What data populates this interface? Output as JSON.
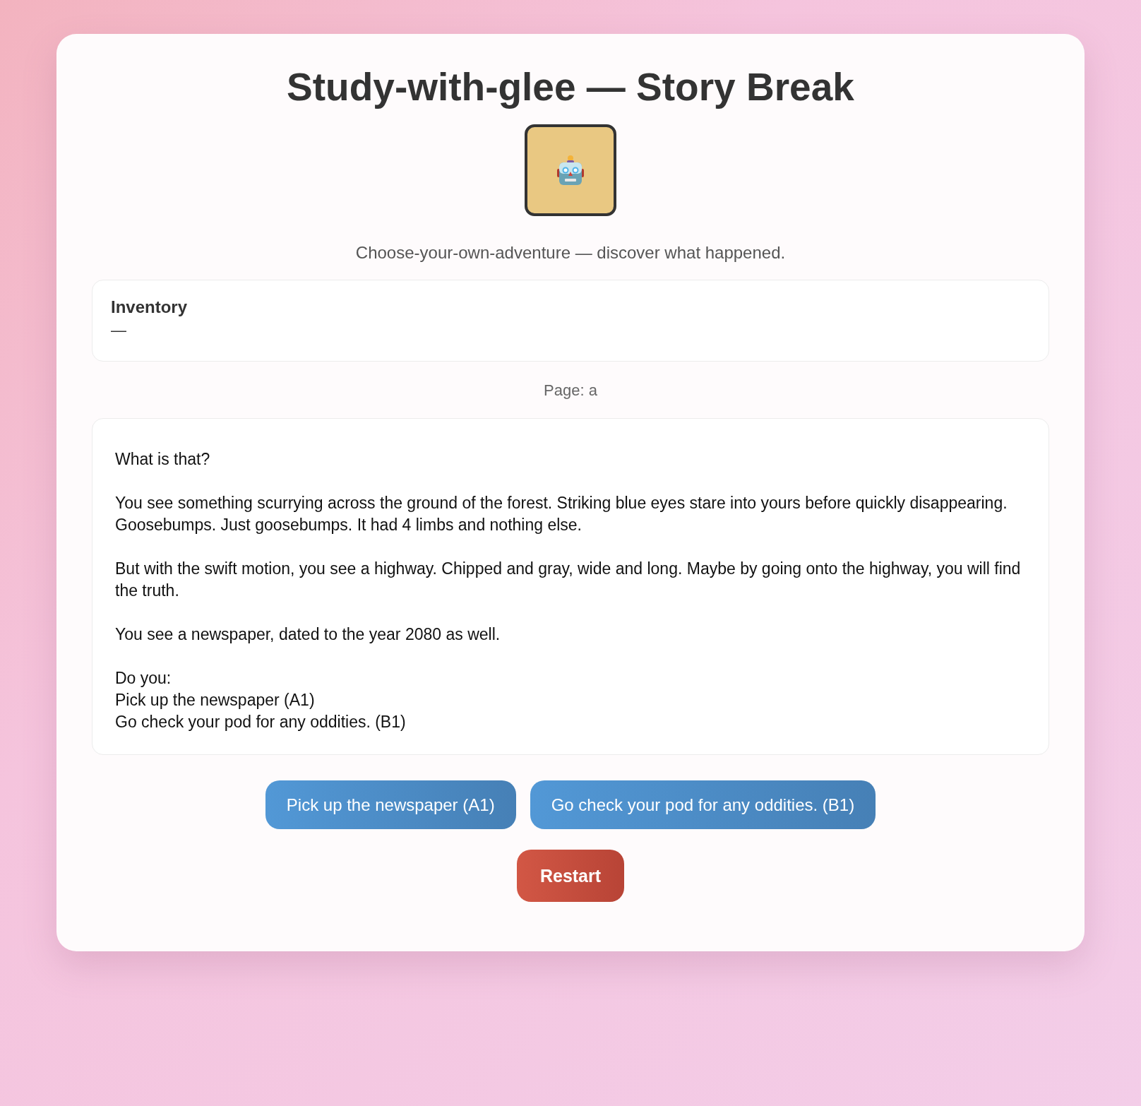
{
  "title": "Study-with-glee — Story Break",
  "subtitle": "Choose-your-own-adventure — discover what happened.",
  "inventory": {
    "heading": "Inventory",
    "value": "—"
  },
  "page_label": "Page: a",
  "story": [
    "What is that?",
    "You see something scurrying across the ground of the forest. Striking blue eyes stare into yours before quickly disappearing. Goosebumps. Just goosebumps. It had 4 limbs and nothing else.",
    "But with the swift motion, you see a highway. Chipped and gray, wide and long. Maybe by going onto the highway, you will find the truth.",
    "You see a newspaper, dated to the year 2080 as well.",
    "Do you:\nPick up the newspaper (A1)\nGo check your pod for any oddities. (B1)"
  ],
  "choices": [
    "Pick up the newspaper (A1)",
    "Go check your pod for any oddities. (B1)"
  ],
  "restart": "Restart"
}
